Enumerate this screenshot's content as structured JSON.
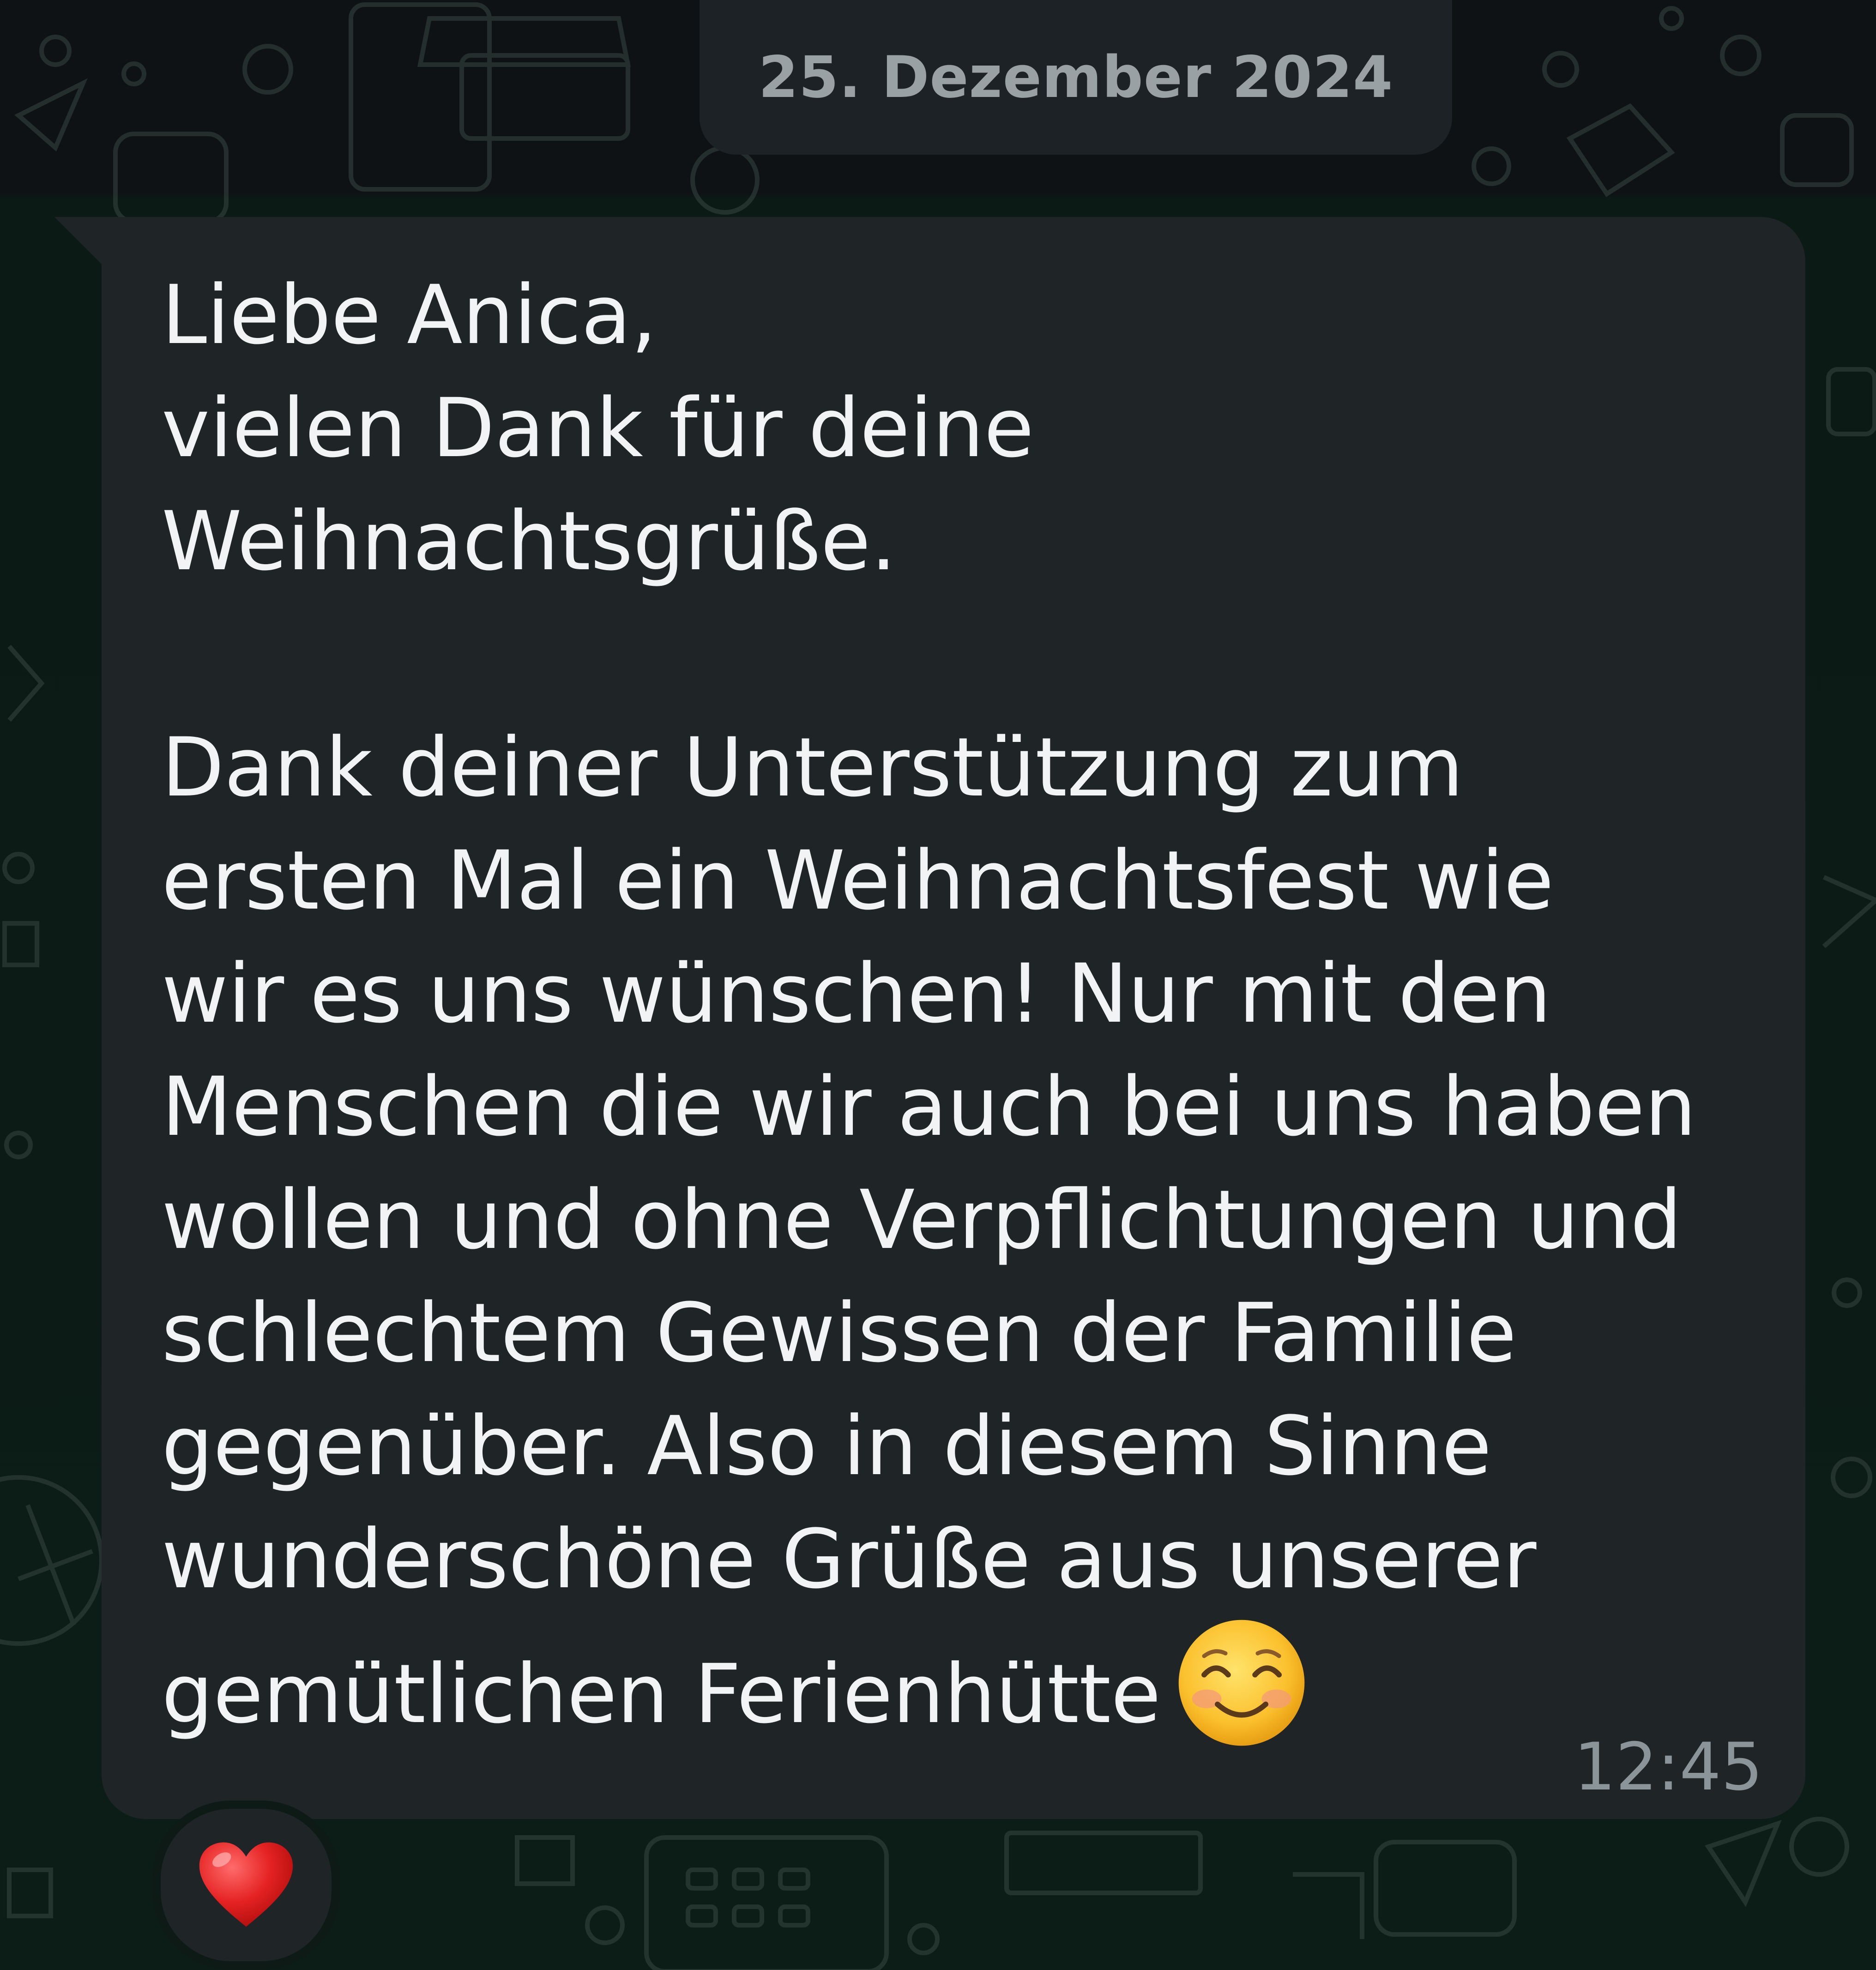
{
  "date_separator": "25. Dezember 2024",
  "message": {
    "text": "Liebe Anica,\nvielen Dank für deine\nWeihnachtsgrüße.\n\nDank deiner Unterstützung zum\nersten Mal ein Weihnachtsfest wie\nwir es uns wünschen! Nur mit den\nMenschen die wir auch bei uns haben\nwollen und ohne Verpflichtungen und\nschlechtem Gewissen der Familie\ngegenüber. Also in diesem Sinne\nwunderschöne Grüße aus unserer\ngemütlichen Ferienhütte",
    "trailing_emoji": "smiling-face-with-smiling-eyes",
    "time": "12:45",
    "reaction": "red-heart"
  },
  "colors": {
    "background": "#0c1c16",
    "bubble": "#1f2427",
    "text": "#f1f3f4",
    "timestamp": "#8b9499",
    "date_chip_text": "#9aa1a5"
  }
}
